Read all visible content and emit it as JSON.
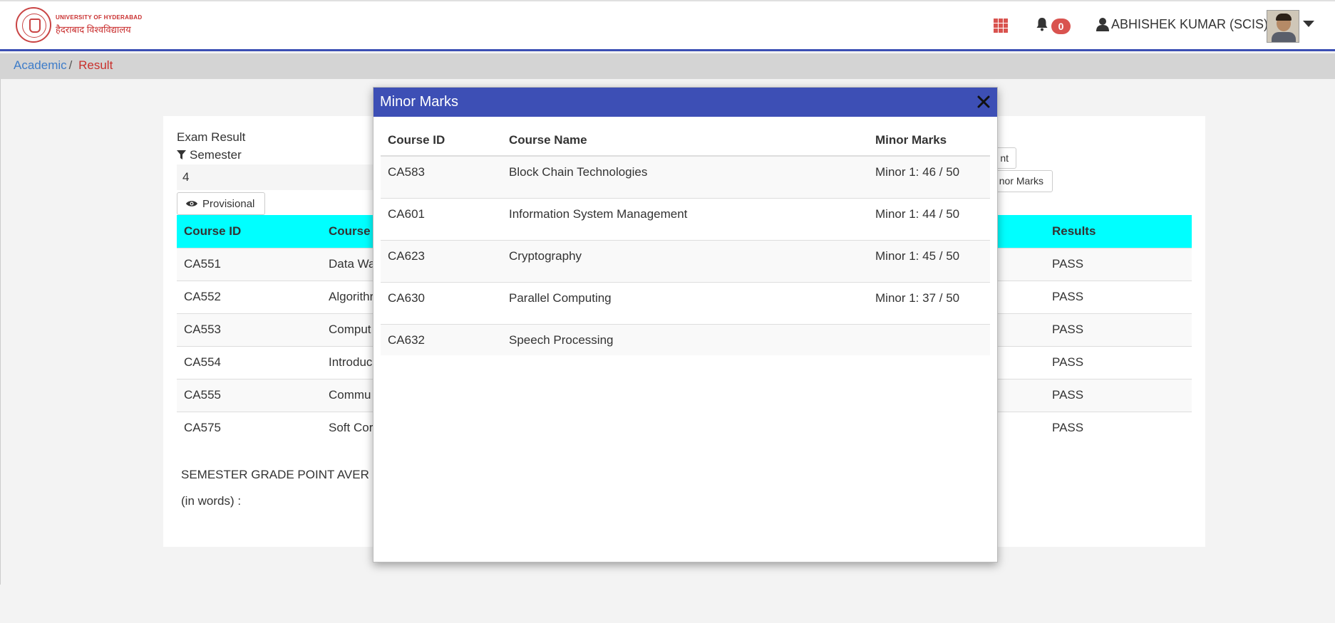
{
  "header": {
    "logo_en": "UNIVERSITY OF HYDERABAD",
    "logo_hi": "हैदराबाद विश्वविद्यालय",
    "notification_count": "0",
    "user_name": "ABHISHEK KUMAR (SCIS)"
  },
  "breadcrumb": {
    "items": [
      "Academic",
      "Result"
    ],
    "separator": "/"
  },
  "panel": {
    "exam_label": "Exam Result",
    "filter_label": "Semester",
    "semester_value": "4",
    "provisional_button": "Provisional",
    "side_button_1": "nt",
    "side_button_2": "nor Marks",
    "sgpa_label": "SEMESTER GRADE POINT AVER",
    "in_words_label": "(in words) :"
  },
  "result_table": {
    "headers": [
      "Course ID",
      "Course",
      "Results"
    ],
    "rows": [
      {
        "course_id": "CA551",
        "course": "Data Wa",
        "result": "PASS"
      },
      {
        "course_id": "CA552",
        "course": "Algorithr",
        "result": "PASS"
      },
      {
        "course_id": "CA553",
        "course": "Comput",
        "result": "PASS"
      },
      {
        "course_id": "CA554",
        "course": "Introduc",
        "result": "PASS"
      },
      {
        "course_id": "CA555",
        "course": "Commu",
        "result": "PASS"
      },
      {
        "course_id": "CA575",
        "course": "Soft Cor",
        "result": "PASS"
      }
    ]
  },
  "modal": {
    "title": "Minor Marks",
    "headers": [
      "Course ID",
      "Course Name",
      "Minor Marks"
    ],
    "rows": [
      {
        "course_id": "CA583",
        "course_name": "Block Chain Technologies",
        "marks": "Minor 1: 46 / 50"
      },
      {
        "course_id": "CA601",
        "course_name": "Information System Management",
        "marks": "Minor 1: 44 / 50"
      },
      {
        "course_id": "CA623",
        "course_name": "Cryptography",
        "marks": "Minor 1: 45 / 50"
      },
      {
        "course_id": "CA630",
        "course_name": "Parallel Computing",
        "marks": "Minor 1: 37 / 50"
      },
      {
        "course_id": "CA632",
        "course_name": "Speech Processing",
        "marks": ""
      }
    ]
  },
  "colors": {
    "header_accent": "#3b4fb4",
    "table_header_bg": "#00ffff",
    "badge_red": "#d9534f",
    "breadcrumb_link": "#3d7cc9",
    "breadcrumb_active": "#c9302c"
  },
  "icons": [
    "apps-grid-icon",
    "bell-icon",
    "user-icon",
    "caret-down-icon",
    "filter-icon",
    "eye-icon",
    "close-icon",
    "university-seal-logo"
  ]
}
